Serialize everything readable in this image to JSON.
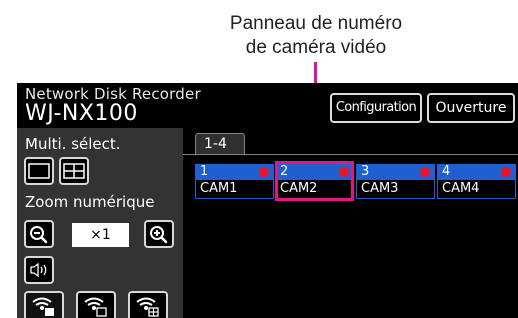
{
  "callout": {
    "line1": "Panneau de numéro",
    "line2": "de caméra vidéo",
    "color": "#e0168f"
  },
  "header": {
    "subtitle": "Network Disk Recorder",
    "title": "WJ-NX100"
  },
  "buttons": {
    "configuration": "Configuration",
    "open": "Ouverture"
  },
  "sidebar": {
    "multi_label": "Multi. sélect.",
    "zoom_label": "Zoom numérique",
    "zoom_value": "×1"
  },
  "tab": {
    "label": "1-4"
  },
  "cameras": [
    {
      "number": "1",
      "name": "CAM1"
    },
    {
      "number": "2",
      "name": "CAM2"
    },
    {
      "number": "3",
      "name": "CAM3"
    },
    {
      "number": "4",
      "name": "CAM4"
    }
  ],
  "colors": {
    "camera_header": "#1f5fd0",
    "recording_dot": "#e8142c",
    "sidebar": "#333333"
  }
}
